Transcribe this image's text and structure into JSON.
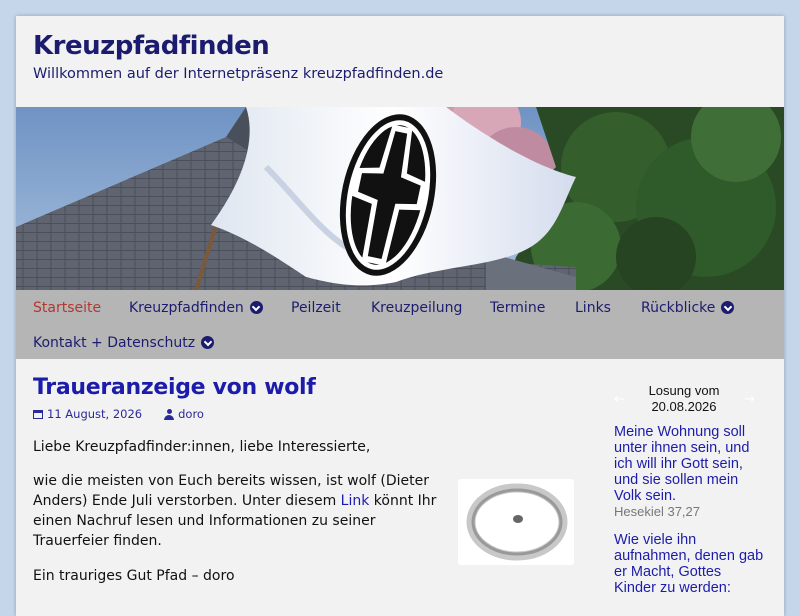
{
  "site": {
    "title": "Kreuzpfadfinden",
    "description": "Willkommen auf der Internetpräsenz kreuzpfadfinden.de"
  },
  "nav": {
    "items": [
      {
        "label": "Startseite",
        "active": true,
        "dropdown": false
      },
      {
        "label": "Kreuzpfadfinden",
        "active": false,
        "dropdown": true
      },
      {
        "label": "Peilzeit",
        "active": false,
        "dropdown": false
      },
      {
        "label": "Kreuzpeilung",
        "active": false,
        "dropdown": false
      },
      {
        "label": "Termine",
        "active": false,
        "dropdown": false
      },
      {
        "label": "Links",
        "active": false,
        "dropdown": false
      },
      {
        "label": "Rückblicke",
        "active": false,
        "dropdown": true
      },
      {
        "label": "Kontakt + Datenschutz",
        "active": false,
        "dropdown": true
      }
    ]
  },
  "post": {
    "title": "Traueranzeige von wolf",
    "date": "11 August, 2026",
    "author": "doro",
    "p1": "Liebe Kreuzpfadfinder:innen, liebe Interessierte,",
    "p2_before": "wie die meisten von Euch bereits wissen, ist wolf (Dieter Anders) Ende Juli verstorben. Unter diesem ",
    "p2_link": "Link",
    "p2_after": " könnt Ihr einen Nachruf lesen und Informationen zu seiner Trauerfeier finden.",
    "p3": "Ein trauriges Gut Pfad – doro"
  },
  "sidebar": {
    "losung_title_line1": "Losung vom",
    "losung_title_line2": "20.08.2026",
    "prev_label": "←",
    "next_label": "→",
    "verse1": "Meine Wohnung soll unter ihnen sein, und ich will ihr Gott sein, und sie sollen mein Volk sein.",
    "verse1_ref": "Hesekiel 37,27",
    "verse2": "Wie viele ihn aufnahmen, denen gab er Macht, Gottes Kinder zu werden:"
  },
  "colors": {
    "accent": "#1c1c6e",
    "link": "#1c1caa",
    "active_nav": "#b0392e",
    "nav_bg": "#b5b5b5",
    "page_bg": "#c5d6ea"
  }
}
